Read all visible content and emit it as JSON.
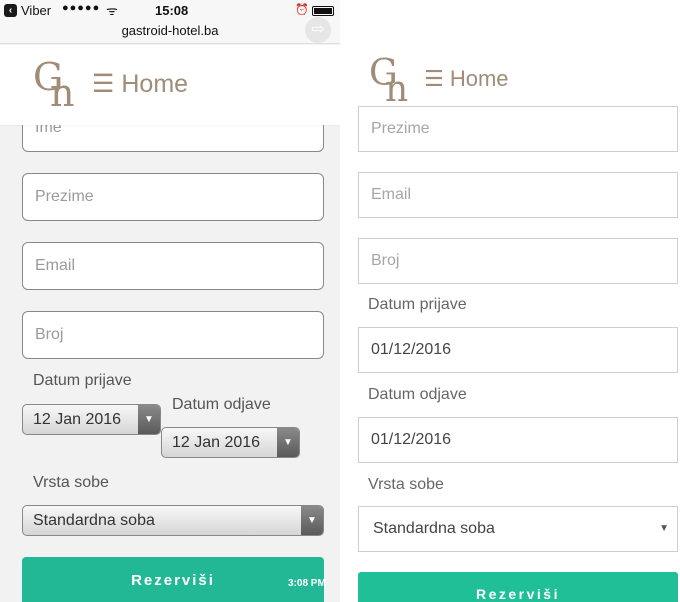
{
  "status_bar": {
    "back_app": "Viber",
    "signal": "●●●●●",
    "wifi": "ᯤ",
    "time": "15:08",
    "alarm": "⏰"
  },
  "url_bar": {
    "domain": "gastroid-hotel.ba",
    "reader_icon": "⇨"
  },
  "header": {
    "menu_label": "☰ Home",
    "logo_g": "G",
    "logo_n": "n"
  },
  "mobile_form": {
    "ime_placeholder": "Ime",
    "prezime_placeholder": "Prezime",
    "email_placeholder": "Email",
    "broj_placeholder": "Broj",
    "datum_prijave_label": "Datum prijave",
    "datum_prijave_value": "12 Jan 2016",
    "datum_odjave_label": "Datum odjave",
    "datum_odjave_value": "12 Jan 2016",
    "vrsta_sobe_label": "Vrsta sobe",
    "vrsta_sobe_value": "Standardna soba",
    "submit_label": "Rezerviši",
    "clock_overlay": "3:08 PM"
  },
  "desktop_form": {
    "prezime_placeholder": "Prezime",
    "email_placeholder": "Email",
    "broj_placeholder": "Broj",
    "datum_prijave_label": "Datum prijave",
    "datum_prijave_value": "01/12/2016",
    "datum_odjave_label": "Datum odjave",
    "datum_odjave_value": "01/12/2016",
    "vrsta_sobe_label": "Vrsta sobe",
    "vrsta_sobe_value": "Standardna soba",
    "submit_label": "Rezerviši"
  },
  "colors": {
    "brand_brown": "#a08c77",
    "button_green": "#23b895"
  }
}
